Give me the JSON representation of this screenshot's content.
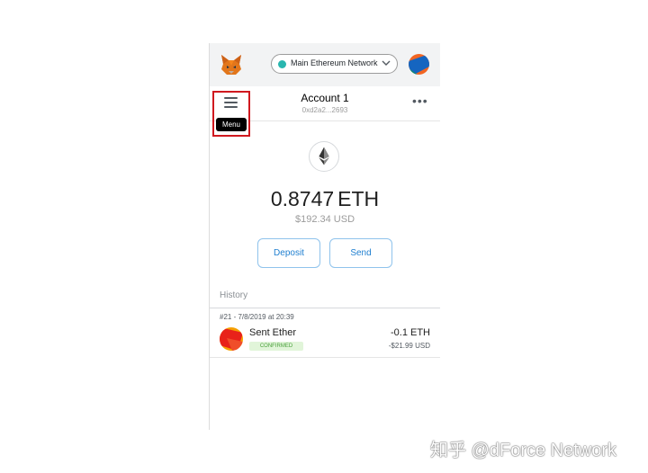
{
  "network": {
    "label": "Main Ethereum Network",
    "dot_color": "#29b6af"
  },
  "account": {
    "name": "Account 1",
    "address": "0xd2a2...2693",
    "more_icon": "more-dots-icon"
  },
  "menu": {
    "tooltip": "Menu",
    "icon": "hamburger-icon",
    "highlight_color": "#d0191f"
  },
  "wallet": {
    "balance": "0.8747",
    "unit": "ETH",
    "fiat": "$192.34 USD"
  },
  "actions": {
    "deposit": "Deposit",
    "send": "Send",
    "accent": "#1f7fd0"
  },
  "history": {
    "label": "History",
    "transactions": [
      {
        "meta": "#21 - 7/8/2019 at 20:39",
        "title": "Sent Ether",
        "status": "CONFIRMED",
        "amount": "-0.1 ETH",
        "fiat": "-$21.99 USD"
      }
    ]
  },
  "watermark": "知乎 @dForce Network"
}
